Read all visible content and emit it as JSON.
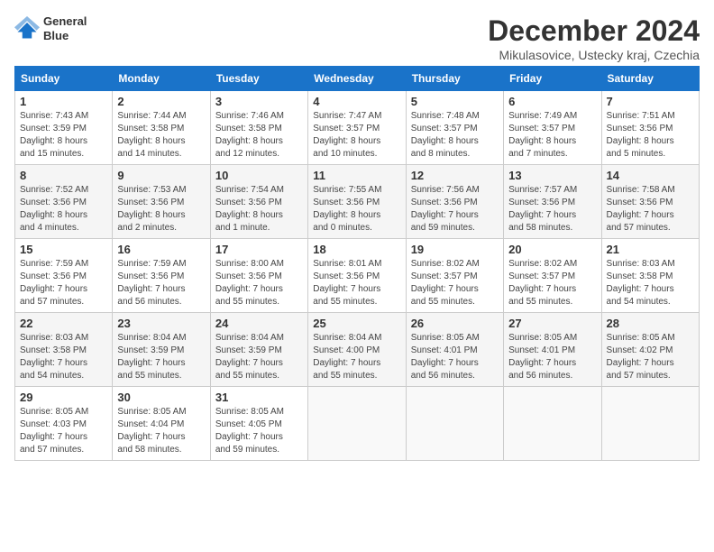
{
  "header": {
    "logo_line1": "General",
    "logo_line2": "Blue",
    "month": "December 2024",
    "location": "Mikulasovice, Ustecky kraj, Czechia"
  },
  "weekdays": [
    "Sunday",
    "Monday",
    "Tuesday",
    "Wednesday",
    "Thursday",
    "Friday",
    "Saturday"
  ],
  "weeks": [
    [
      {
        "day": "1",
        "info": "Sunrise: 7:43 AM\nSunset: 3:59 PM\nDaylight: 8 hours\nand 15 minutes."
      },
      {
        "day": "2",
        "info": "Sunrise: 7:44 AM\nSunset: 3:58 PM\nDaylight: 8 hours\nand 14 minutes."
      },
      {
        "day": "3",
        "info": "Sunrise: 7:46 AM\nSunset: 3:58 PM\nDaylight: 8 hours\nand 12 minutes."
      },
      {
        "day": "4",
        "info": "Sunrise: 7:47 AM\nSunset: 3:57 PM\nDaylight: 8 hours\nand 10 minutes."
      },
      {
        "day": "5",
        "info": "Sunrise: 7:48 AM\nSunset: 3:57 PM\nDaylight: 8 hours\nand 8 minutes."
      },
      {
        "day": "6",
        "info": "Sunrise: 7:49 AM\nSunset: 3:57 PM\nDaylight: 8 hours\nand 7 minutes."
      },
      {
        "day": "7",
        "info": "Sunrise: 7:51 AM\nSunset: 3:56 PM\nDaylight: 8 hours\nand 5 minutes."
      }
    ],
    [
      {
        "day": "8",
        "info": "Sunrise: 7:52 AM\nSunset: 3:56 PM\nDaylight: 8 hours\nand 4 minutes."
      },
      {
        "day": "9",
        "info": "Sunrise: 7:53 AM\nSunset: 3:56 PM\nDaylight: 8 hours\nand 2 minutes."
      },
      {
        "day": "10",
        "info": "Sunrise: 7:54 AM\nSunset: 3:56 PM\nDaylight: 8 hours\nand 1 minute."
      },
      {
        "day": "11",
        "info": "Sunrise: 7:55 AM\nSunset: 3:56 PM\nDaylight: 8 hours\nand 0 minutes."
      },
      {
        "day": "12",
        "info": "Sunrise: 7:56 AM\nSunset: 3:56 PM\nDaylight: 7 hours\nand 59 minutes."
      },
      {
        "day": "13",
        "info": "Sunrise: 7:57 AM\nSunset: 3:56 PM\nDaylight: 7 hours\nand 58 minutes."
      },
      {
        "day": "14",
        "info": "Sunrise: 7:58 AM\nSunset: 3:56 PM\nDaylight: 7 hours\nand 57 minutes."
      }
    ],
    [
      {
        "day": "15",
        "info": "Sunrise: 7:59 AM\nSunset: 3:56 PM\nDaylight: 7 hours\nand 57 minutes."
      },
      {
        "day": "16",
        "info": "Sunrise: 7:59 AM\nSunset: 3:56 PM\nDaylight: 7 hours\nand 56 minutes."
      },
      {
        "day": "17",
        "info": "Sunrise: 8:00 AM\nSunset: 3:56 PM\nDaylight: 7 hours\nand 55 minutes."
      },
      {
        "day": "18",
        "info": "Sunrise: 8:01 AM\nSunset: 3:56 PM\nDaylight: 7 hours\nand 55 minutes."
      },
      {
        "day": "19",
        "info": "Sunrise: 8:02 AM\nSunset: 3:57 PM\nDaylight: 7 hours\nand 55 minutes."
      },
      {
        "day": "20",
        "info": "Sunrise: 8:02 AM\nSunset: 3:57 PM\nDaylight: 7 hours\nand 55 minutes."
      },
      {
        "day": "21",
        "info": "Sunrise: 8:03 AM\nSunset: 3:58 PM\nDaylight: 7 hours\nand 54 minutes."
      }
    ],
    [
      {
        "day": "22",
        "info": "Sunrise: 8:03 AM\nSunset: 3:58 PM\nDaylight: 7 hours\nand 54 minutes."
      },
      {
        "day": "23",
        "info": "Sunrise: 8:04 AM\nSunset: 3:59 PM\nDaylight: 7 hours\nand 55 minutes."
      },
      {
        "day": "24",
        "info": "Sunrise: 8:04 AM\nSunset: 3:59 PM\nDaylight: 7 hours\nand 55 minutes."
      },
      {
        "day": "25",
        "info": "Sunrise: 8:04 AM\nSunset: 4:00 PM\nDaylight: 7 hours\nand 55 minutes."
      },
      {
        "day": "26",
        "info": "Sunrise: 8:05 AM\nSunset: 4:01 PM\nDaylight: 7 hours\nand 56 minutes."
      },
      {
        "day": "27",
        "info": "Sunrise: 8:05 AM\nSunset: 4:01 PM\nDaylight: 7 hours\nand 56 minutes."
      },
      {
        "day": "28",
        "info": "Sunrise: 8:05 AM\nSunset: 4:02 PM\nDaylight: 7 hours\nand 57 minutes."
      }
    ],
    [
      {
        "day": "29",
        "info": "Sunrise: 8:05 AM\nSunset: 4:03 PM\nDaylight: 7 hours\nand 57 minutes."
      },
      {
        "day": "30",
        "info": "Sunrise: 8:05 AM\nSunset: 4:04 PM\nDaylight: 7 hours\nand 58 minutes."
      },
      {
        "day": "31",
        "info": "Sunrise: 8:05 AM\nSunset: 4:05 PM\nDaylight: 7 hours\nand 59 minutes."
      },
      {
        "day": "",
        "info": ""
      },
      {
        "day": "",
        "info": ""
      },
      {
        "day": "",
        "info": ""
      },
      {
        "day": "",
        "info": ""
      }
    ]
  ]
}
